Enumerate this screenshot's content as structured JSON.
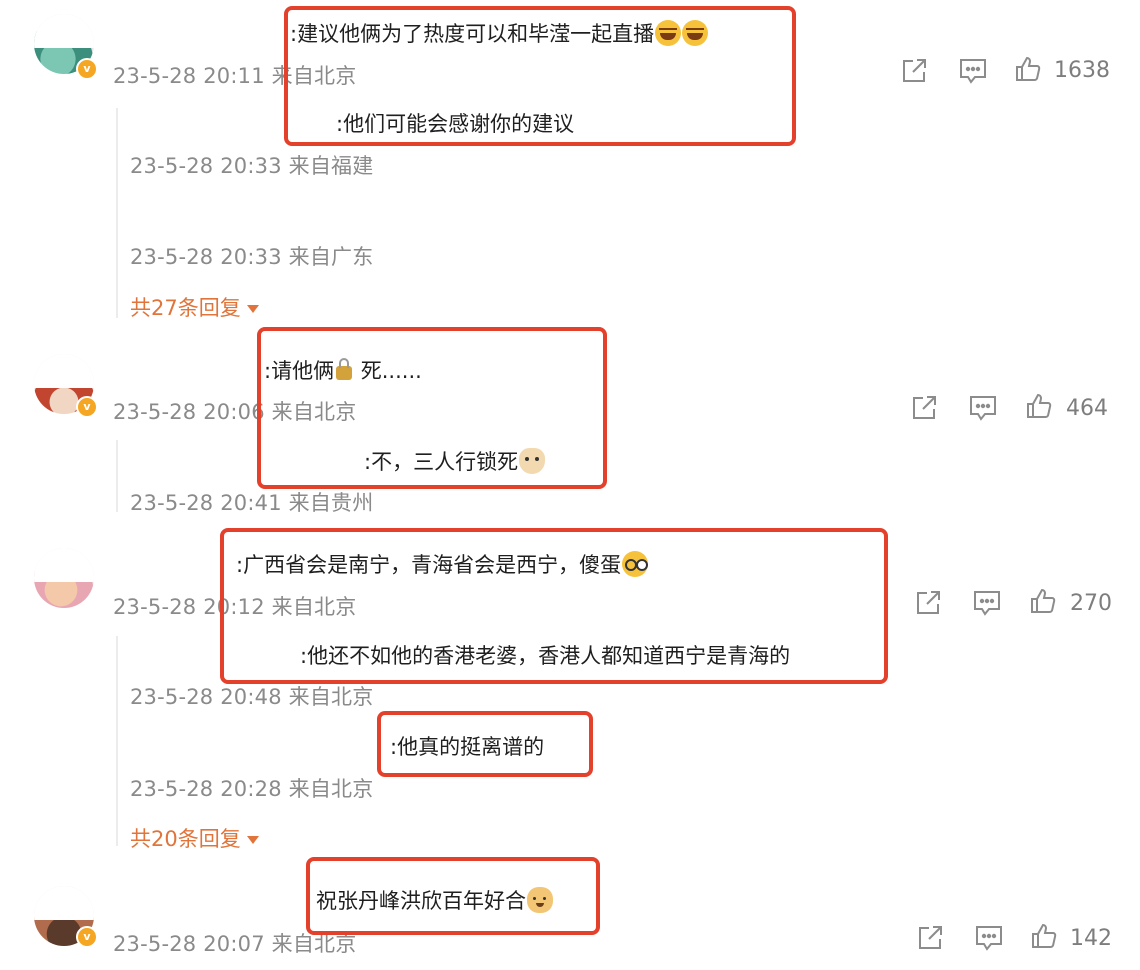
{
  "comments": [
    {
      "content": ":建议他俩为了热度可以和毕滢一起直播",
      "meta": "23-5-28 20:11 来自北京",
      "likes": "1638",
      "replies": [
        {
          "content": ":他们可能会感谢你的建议",
          "meta": "23-5-28 20:33 来自福建"
        },
        {
          "content": "",
          "meta": "23-5-28 20:33 来自广东"
        }
      ],
      "more_replies": "共27条回复"
    },
    {
      "content_prefix": ":请他俩",
      "content_suffix": " 死......",
      "meta": "23-5-28 20:06 来自北京",
      "likes": "464",
      "replies": [
        {
          "content": ":不，三人行锁死",
          "meta": "23-5-28 20:41 来自贵州"
        }
      ]
    },
    {
      "content": ":广西省会是南宁，青海省会是西宁，傻蛋",
      "meta": "23-5-28 20:12 来自北京",
      "likes": "270",
      "replies": [
        {
          "content": ":他还不如他的香港老婆，香港人都知道西宁是青海的",
          "meta": "23-5-28 20:48 来自北京"
        },
        {
          "content": ":他真的挺离谱的",
          "meta": "23-5-28 20:28 来自北京"
        }
      ],
      "more_replies": "共20条回复"
    },
    {
      "content": "祝张丹峰洪欣百年好合",
      "meta": "23-5-28 20:07 来自北京",
      "likes": "142"
    }
  ],
  "icons": {
    "share": "share-icon",
    "comment": "comment-icon",
    "like": "thumbs-up-icon",
    "verified": "verified-badge-icon"
  },
  "colors": {
    "highlight": "#e4412d",
    "more_link": "#e0743a",
    "meta_text": "#8a8a8a",
    "verified": "#f5a623"
  }
}
